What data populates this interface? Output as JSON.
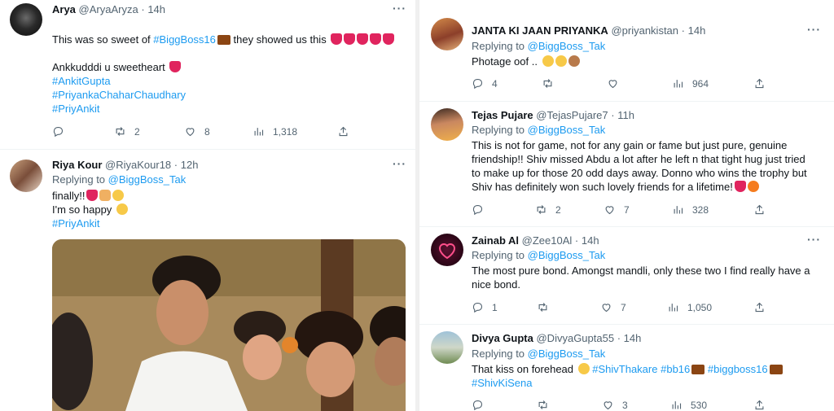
{
  "left": {
    "tweet1": {
      "name": "Arya",
      "handle": "@AryaAryza",
      "dot": "·",
      "time": "14h",
      "line1_a": "This was so sweet of ",
      "line1_tag": "#BiggBoss16",
      "line1_b": " they showed us this",
      "line2": "Ankkudddi u sweetheart",
      "tags": [
        "#AnkitGupta",
        "#PriyankaChaharChaudhary",
        "#PriyAnkit"
      ],
      "replies": "",
      "retweets": "2",
      "likes": "8",
      "views": "1,318"
    },
    "tweet2": {
      "name": "Riya Kour",
      "handle": "@RiyaKour18",
      "dot": "·",
      "time": "12h",
      "replying_prefix": "Replying to ",
      "replying_to": "@BiggBoss_Tak",
      "line1": "finally!!",
      "line2": "I'm so happy",
      "tag": "#PriyAnkit"
    }
  },
  "right": {
    "tweets": [
      {
        "name": "JANTA KI JAAN PRIYANKA",
        "handle": "@priyankistan",
        "dot": "·",
        "time": "14h",
        "replying_prefix": "Replying to ",
        "replying_to": "@BiggBoss_Tak",
        "text": "Photage oof ..",
        "replies": "4",
        "retweets": "",
        "likes": "",
        "views": "964"
      },
      {
        "name": "Tejas Pujare",
        "handle": "@TejasPujare7",
        "dot": "·",
        "time": "11h",
        "replying_prefix": "Replying to ",
        "replying_to": "@BiggBoss_Tak",
        "lines": [
          "This is not for game, not for any gain or fame but just pure, genuine",
          "friendship!! Shiv missed Abdu a lot after he left n that tight hug just tried",
          "to make up for those 20 odd days away. Donno who wins the trophy but",
          "Shiv has definitely won such lovely friends for a lifetime!"
        ],
        "replies": "",
        "retweets": "2",
        "likes": "7",
        "views": "328"
      },
      {
        "name": "Zainab Al",
        "handle": "@Zee10Al",
        "dot": "·",
        "time": "14h",
        "replying_prefix": "Replying to ",
        "replying_to": "@BiggBoss_Tak",
        "lines": [
          "The most pure bond. Amongst mandli, only these two I find really have a",
          "nice bond."
        ],
        "replies": "1",
        "retweets": "",
        "likes": "7",
        "views": "1,050"
      },
      {
        "name": "Divya Gupta",
        "handle": "@DivyaGupta55",
        "dot": "·",
        "time": "14h",
        "replying_prefix": "Replying to ",
        "replying_to": "@BiggBoss_Tak",
        "text_a": "That kiss on forehead ",
        "tags": [
          "#ShivThakare",
          "#bb16",
          "#biggboss16",
          "#ShivKiSena"
        ],
        "replies": "",
        "retweets": "",
        "likes": "3",
        "views": "530"
      }
    ]
  },
  "more_label": "···",
  "colors": {
    "link": "#1d9bf0",
    "muted": "#536471",
    "heart": "#e0245e"
  }
}
